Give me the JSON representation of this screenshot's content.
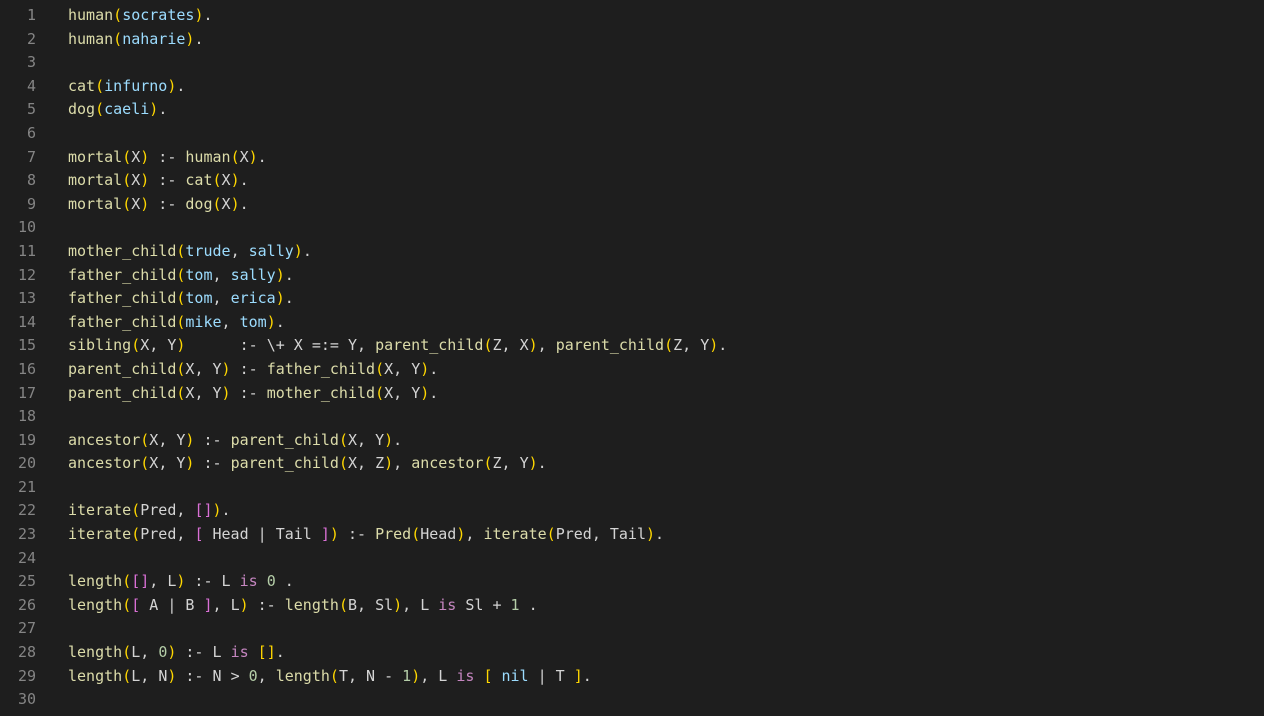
{
  "lines": [
    {
      "num": "1",
      "tokens": [
        {
          "t": "human",
          "c": "fn"
        },
        {
          "t": "(",
          "c": "paren"
        },
        {
          "t": "socrates",
          "c": "atom"
        },
        {
          "t": ")",
          "c": "paren"
        },
        {
          "t": ".",
          "c": "punct"
        }
      ]
    },
    {
      "num": "2",
      "tokens": [
        {
          "t": "human",
          "c": "fn"
        },
        {
          "t": "(",
          "c": "paren"
        },
        {
          "t": "naharie",
          "c": "atom"
        },
        {
          "t": ")",
          "c": "paren"
        },
        {
          "t": ".",
          "c": "punct"
        }
      ]
    },
    {
      "num": "3",
      "tokens": []
    },
    {
      "num": "4",
      "tokens": [
        {
          "t": "cat",
          "c": "fn"
        },
        {
          "t": "(",
          "c": "paren"
        },
        {
          "t": "infurno",
          "c": "atom"
        },
        {
          "t": ")",
          "c": "paren"
        },
        {
          "t": ".",
          "c": "punct"
        }
      ]
    },
    {
      "num": "5",
      "tokens": [
        {
          "t": "dog",
          "c": "fn"
        },
        {
          "t": "(",
          "c": "paren"
        },
        {
          "t": "caeli",
          "c": "atom"
        },
        {
          "t": ")",
          "c": "paren"
        },
        {
          "t": ".",
          "c": "punct"
        }
      ]
    },
    {
      "num": "6",
      "tokens": []
    },
    {
      "num": "7",
      "tokens": [
        {
          "t": "mortal",
          "c": "fn"
        },
        {
          "t": "(",
          "c": "paren"
        },
        {
          "t": "X",
          "c": "var"
        },
        {
          "t": ")",
          "c": "paren"
        },
        {
          "t": " :- ",
          "c": "op"
        },
        {
          "t": "human",
          "c": "fn"
        },
        {
          "t": "(",
          "c": "paren"
        },
        {
          "t": "X",
          "c": "var"
        },
        {
          "t": ")",
          "c": "paren"
        },
        {
          "t": ".",
          "c": "punct"
        }
      ]
    },
    {
      "num": "8",
      "tokens": [
        {
          "t": "mortal",
          "c": "fn"
        },
        {
          "t": "(",
          "c": "paren"
        },
        {
          "t": "X",
          "c": "var"
        },
        {
          "t": ")",
          "c": "paren"
        },
        {
          "t": " :- ",
          "c": "op"
        },
        {
          "t": "cat",
          "c": "fn"
        },
        {
          "t": "(",
          "c": "paren"
        },
        {
          "t": "X",
          "c": "var"
        },
        {
          "t": ")",
          "c": "paren"
        },
        {
          "t": ".",
          "c": "punct"
        }
      ]
    },
    {
      "num": "9",
      "tokens": [
        {
          "t": "mortal",
          "c": "fn"
        },
        {
          "t": "(",
          "c": "paren"
        },
        {
          "t": "X",
          "c": "var"
        },
        {
          "t": ")",
          "c": "paren"
        },
        {
          "t": " :- ",
          "c": "op"
        },
        {
          "t": "dog",
          "c": "fn"
        },
        {
          "t": "(",
          "c": "paren"
        },
        {
          "t": "X",
          "c": "var"
        },
        {
          "t": ")",
          "c": "paren"
        },
        {
          "t": ".",
          "c": "punct"
        }
      ]
    },
    {
      "num": "10",
      "tokens": []
    },
    {
      "num": "11",
      "tokens": [
        {
          "t": "mother_child",
          "c": "fn"
        },
        {
          "t": "(",
          "c": "paren"
        },
        {
          "t": "trude",
          "c": "atom"
        },
        {
          "t": ", ",
          "c": "punct"
        },
        {
          "t": "sally",
          "c": "atom"
        },
        {
          "t": ")",
          "c": "paren"
        },
        {
          "t": ".",
          "c": "punct"
        }
      ]
    },
    {
      "num": "12",
      "tokens": [
        {
          "t": "father_child",
          "c": "fn"
        },
        {
          "t": "(",
          "c": "paren"
        },
        {
          "t": "tom",
          "c": "atom"
        },
        {
          "t": ", ",
          "c": "punct"
        },
        {
          "t": "sally",
          "c": "atom"
        },
        {
          "t": ")",
          "c": "paren"
        },
        {
          "t": ".",
          "c": "punct"
        }
      ]
    },
    {
      "num": "13",
      "tokens": [
        {
          "t": "father_child",
          "c": "fn"
        },
        {
          "t": "(",
          "c": "paren"
        },
        {
          "t": "tom",
          "c": "atom"
        },
        {
          "t": ", ",
          "c": "punct"
        },
        {
          "t": "erica",
          "c": "atom"
        },
        {
          "t": ")",
          "c": "paren"
        },
        {
          "t": ".",
          "c": "punct"
        }
      ]
    },
    {
      "num": "14",
      "tokens": [
        {
          "t": "father_child",
          "c": "fn"
        },
        {
          "t": "(",
          "c": "paren"
        },
        {
          "t": "mike",
          "c": "atom"
        },
        {
          "t": ", ",
          "c": "punct"
        },
        {
          "t": "tom",
          "c": "atom"
        },
        {
          "t": ")",
          "c": "paren"
        },
        {
          "t": ".",
          "c": "punct"
        }
      ]
    },
    {
      "num": "15",
      "tokens": [
        {
          "t": "sibling",
          "c": "fn"
        },
        {
          "t": "(",
          "c": "paren"
        },
        {
          "t": "X",
          "c": "var"
        },
        {
          "t": ", ",
          "c": "punct"
        },
        {
          "t": "Y",
          "c": "var"
        },
        {
          "t": ")",
          "c": "paren"
        },
        {
          "t": "      :- ",
          "c": "op"
        },
        {
          "t": "\\+",
          "c": "op"
        },
        {
          "t": " X ",
          "c": "var"
        },
        {
          "t": "=:=",
          "c": "op"
        },
        {
          "t": " Y",
          "c": "var"
        },
        {
          "t": ", ",
          "c": "punct"
        },
        {
          "t": "parent_child",
          "c": "fn"
        },
        {
          "t": "(",
          "c": "paren"
        },
        {
          "t": "Z",
          "c": "var"
        },
        {
          "t": ", ",
          "c": "punct"
        },
        {
          "t": "X",
          "c": "var"
        },
        {
          "t": ")",
          "c": "paren"
        },
        {
          "t": ", ",
          "c": "punct"
        },
        {
          "t": "parent_child",
          "c": "fn"
        },
        {
          "t": "(",
          "c": "paren"
        },
        {
          "t": "Z",
          "c": "var"
        },
        {
          "t": ", ",
          "c": "punct"
        },
        {
          "t": "Y",
          "c": "var"
        },
        {
          "t": ")",
          "c": "paren"
        },
        {
          "t": ".",
          "c": "punct"
        }
      ]
    },
    {
      "num": "16",
      "tokens": [
        {
          "t": "parent_child",
          "c": "fn"
        },
        {
          "t": "(",
          "c": "paren"
        },
        {
          "t": "X",
          "c": "var"
        },
        {
          "t": ", ",
          "c": "punct"
        },
        {
          "t": "Y",
          "c": "var"
        },
        {
          "t": ")",
          "c": "paren"
        },
        {
          "t": " :- ",
          "c": "op"
        },
        {
          "t": "father_child",
          "c": "fn"
        },
        {
          "t": "(",
          "c": "paren"
        },
        {
          "t": "X",
          "c": "var"
        },
        {
          "t": ", ",
          "c": "punct"
        },
        {
          "t": "Y",
          "c": "var"
        },
        {
          "t": ")",
          "c": "paren"
        },
        {
          "t": ".",
          "c": "punct"
        }
      ]
    },
    {
      "num": "17",
      "tokens": [
        {
          "t": "parent_child",
          "c": "fn"
        },
        {
          "t": "(",
          "c": "paren"
        },
        {
          "t": "X",
          "c": "var"
        },
        {
          "t": ", ",
          "c": "punct"
        },
        {
          "t": "Y",
          "c": "var"
        },
        {
          "t": ")",
          "c": "paren"
        },
        {
          "t": " :- ",
          "c": "op"
        },
        {
          "t": "mother_child",
          "c": "fn"
        },
        {
          "t": "(",
          "c": "paren"
        },
        {
          "t": "X",
          "c": "var"
        },
        {
          "t": ", ",
          "c": "punct"
        },
        {
          "t": "Y",
          "c": "var"
        },
        {
          "t": ")",
          "c": "paren"
        },
        {
          "t": ".",
          "c": "punct"
        }
      ]
    },
    {
      "num": "18",
      "tokens": []
    },
    {
      "num": "19",
      "tokens": [
        {
          "t": "ancestor",
          "c": "fn"
        },
        {
          "t": "(",
          "c": "paren"
        },
        {
          "t": "X",
          "c": "var"
        },
        {
          "t": ", ",
          "c": "punct"
        },
        {
          "t": "Y",
          "c": "var"
        },
        {
          "t": ")",
          "c": "paren"
        },
        {
          "t": " :- ",
          "c": "op"
        },
        {
          "t": "parent_child",
          "c": "fn"
        },
        {
          "t": "(",
          "c": "paren"
        },
        {
          "t": "X",
          "c": "var"
        },
        {
          "t": ", ",
          "c": "punct"
        },
        {
          "t": "Y",
          "c": "var"
        },
        {
          "t": ")",
          "c": "paren"
        },
        {
          "t": ".",
          "c": "punct"
        }
      ]
    },
    {
      "num": "20",
      "tokens": [
        {
          "t": "ancestor",
          "c": "fn"
        },
        {
          "t": "(",
          "c": "paren"
        },
        {
          "t": "X",
          "c": "var"
        },
        {
          "t": ", ",
          "c": "punct"
        },
        {
          "t": "Y",
          "c": "var"
        },
        {
          "t": ")",
          "c": "paren"
        },
        {
          "t": " :- ",
          "c": "op"
        },
        {
          "t": "parent_child",
          "c": "fn"
        },
        {
          "t": "(",
          "c": "paren"
        },
        {
          "t": "X",
          "c": "var"
        },
        {
          "t": ", ",
          "c": "punct"
        },
        {
          "t": "Z",
          "c": "var"
        },
        {
          "t": ")",
          "c": "paren"
        },
        {
          "t": ", ",
          "c": "punct"
        },
        {
          "t": "ancestor",
          "c": "fn"
        },
        {
          "t": "(",
          "c": "paren"
        },
        {
          "t": "Z",
          "c": "var"
        },
        {
          "t": ", ",
          "c": "punct"
        },
        {
          "t": "Y",
          "c": "var"
        },
        {
          "t": ")",
          "c": "paren"
        },
        {
          "t": ".",
          "c": "punct"
        }
      ]
    },
    {
      "num": "21",
      "tokens": []
    },
    {
      "num": "22",
      "tokens": [
        {
          "t": "iterate",
          "c": "fn"
        },
        {
          "t": "(",
          "c": "paren"
        },
        {
          "t": "Pred",
          "c": "var"
        },
        {
          "t": ", ",
          "c": "punct"
        },
        {
          "t": "[",
          "c": "paren2"
        },
        {
          "t": "]",
          "c": "paren2"
        },
        {
          "t": ")",
          "c": "paren"
        },
        {
          "t": ".",
          "c": "punct"
        }
      ]
    },
    {
      "num": "23",
      "tokens": [
        {
          "t": "iterate",
          "c": "fn"
        },
        {
          "t": "(",
          "c": "paren"
        },
        {
          "t": "Pred",
          "c": "var"
        },
        {
          "t": ", ",
          "c": "punct"
        },
        {
          "t": "[",
          "c": "paren2"
        },
        {
          "t": " Head ",
          "c": "var"
        },
        {
          "t": "|",
          "c": "op"
        },
        {
          "t": " Tail ",
          "c": "var"
        },
        {
          "t": "]",
          "c": "paren2"
        },
        {
          "t": ")",
          "c": "paren"
        },
        {
          "t": " :- ",
          "c": "op"
        },
        {
          "t": "Pred",
          "c": "fn"
        },
        {
          "t": "(",
          "c": "paren"
        },
        {
          "t": "Head",
          "c": "var"
        },
        {
          "t": ")",
          "c": "paren"
        },
        {
          "t": ", ",
          "c": "punct"
        },
        {
          "t": "iterate",
          "c": "fn"
        },
        {
          "t": "(",
          "c": "paren"
        },
        {
          "t": "Pred",
          "c": "var"
        },
        {
          "t": ", ",
          "c": "punct"
        },
        {
          "t": "Tail",
          "c": "var"
        },
        {
          "t": ")",
          "c": "paren"
        },
        {
          "t": ".",
          "c": "punct"
        }
      ]
    },
    {
      "num": "24",
      "tokens": []
    },
    {
      "num": "25",
      "tokens": [
        {
          "t": "length",
          "c": "fn"
        },
        {
          "t": "(",
          "c": "paren"
        },
        {
          "t": "[",
          "c": "paren2"
        },
        {
          "t": "]",
          "c": "paren2"
        },
        {
          "t": ", ",
          "c": "punct"
        },
        {
          "t": "L",
          "c": "var"
        },
        {
          "t": ")",
          "c": "paren"
        },
        {
          "t": " :- ",
          "c": "op"
        },
        {
          "t": "L ",
          "c": "var"
        },
        {
          "t": "is",
          "c": "kw"
        },
        {
          "t": " ",
          "c": "op"
        },
        {
          "t": "0",
          "c": "num"
        },
        {
          "t": " .",
          "c": "punct"
        }
      ]
    },
    {
      "num": "26",
      "tokens": [
        {
          "t": "length",
          "c": "fn"
        },
        {
          "t": "(",
          "c": "paren"
        },
        {
          "t": "[",
          "c": "paren2"
        },
        {
          "t": " A ",
          "c": "var"
        },
        {
          "t": "|",
          "c": "op"
        },
        {
          "t": " B ",
          "c": "var"
        },
        {
          "t": "]",
          "c": "paren2"
        },
        {
          "t": ", ",
          "c": "punct"
        },
        {
          "t": "L",
          "c": "var"
        },
        {
          "t": ")",
          "c": "paren"
        },
        {
          "t": " :- ",
          "c": "op"
        },
        {
          "t": "length",
          "c": "fn"
        },
        {
          "t": "(",
          "c": "paren"
        },
        {
          "t": "B",
          "c": "var"
        },
        {
          "t": ", ",
          "c": "punct"
        },
        {
          "t": "Sl",
          "c": "var"
        },
        {
          "t": ")",
          "c": "paren"
        },
        {
          "t": ", ",
          "c": "punct"
        },
        {
          "t": "L ",
          "c": "var"
        },
        {
          "t": "is",
          "c": "kw"
        },
        {
          "t": " Sl ",
          "c": "var"
        },
        {
          "t": "+",
          "c": "op"
        },
        {
          "t": " ",
          "c": "op"
        },
        {
          "t": "1",
          "c": "num"
        },
        {
          "t": " .",
          "c": "punct"
        }
      ]
    },
    {
      "num": "27",
      "tokens": []
    },
    {
      "num": "28",
      "tokens": [
        {
          "t": "length",
          "c": "fn"
        },
        {
          "t": "(",
          "c": "paren"
        },
        {
          "t": "L",
          "c": "var"
        },
        {
          "t": ", ",
          "c": "punct"
        },
        {
          "t": "0",
          "c": "num"
        },
        {
          "t": ")",
          "c": "paren"
        },
        {
          "t": " :- ",
          "c": "op"
        },
        {
          "t": "L ",
          "c": "var"
        },
        {
          "t": "is",
          "c": "kw"
        },
        {
          "t": " ",
          "c": "op"
        },
        {
          "t": "[",
          "c": "paren"
        },
        {
          "t": "]",
          "c": "paren"
        },
        {
          "t": ".",
          "c": "punct"
        }
      ]
    },
    {
      "num": "29",
      "tokens": [
        {
          "t": "length",
          "c": "fn"
        },
        {
          "t": "(",
          "c": "paren"
        },
        {
          "t": "L",
          "c": "var"
        },
        {
          "t": ", ",
          "c": "punct"
        },
        {
          "t": "N",
          "c": "var"
        },
        {
          "t": ")",
          "c": "paren"
        },
        {
          "t": " :- ",
          "c": "op"
        },
        {
          "t": "N ",
          "c": "var"
        },
        {
          "t": ">",
          "c": "op"
        },
        {
          "t": " ",
          "c": "op"
        },
        {
          "t": "0",
          "c": "num"
        },
        {
          "t": ", ",
          "c": "punct"
        },
        {
          "t": "length",
          "c": "fn"
        },
        {
          "t": "(",
          "c": "paren"
        },
        {
          "t": "T",
          "c": "var"
        },
        {
          "t": ", ",
          "c": "punct"
        },
        {
          "t": "N ",
          "c": "var"
        },
        {
          "t": "-",
          "c": "op"
        },
        {
          "t": " ",
          "c": "op"
        },
        {
          "t": "1",
          "c": "num"
        },
        {
          "t": ")",
          "c": "paren"
        },
        {
          "t": ", ",
          "c": "punct"
        },
        {
          "t": "L ",
          "c": "var"
        },
        {
          "t": "is",
          "c": "kw"
        },
        {
          "t": " ",
          "c": "op"
        },
        {
          "t": "[",
          "c": "paren"
        },
        {
          "t": " ",
          "c": "op"
        },
        {
          "t": "nil",
          "c": "atom"
        },
        {
          "t": " ",
          "c": "op"
        },
        {
          "t": "|",
          "c": "op"
        },
        {
          "t": " T ",
          "c": "var"
        },
        {
          "t": "]",
          "c": "paren"
        },
        {
          "t": ".",
          "c": "punct"
        }
      ]
    },
    {
      "num": "30",
      "tokens": []
    }
  ]
}
